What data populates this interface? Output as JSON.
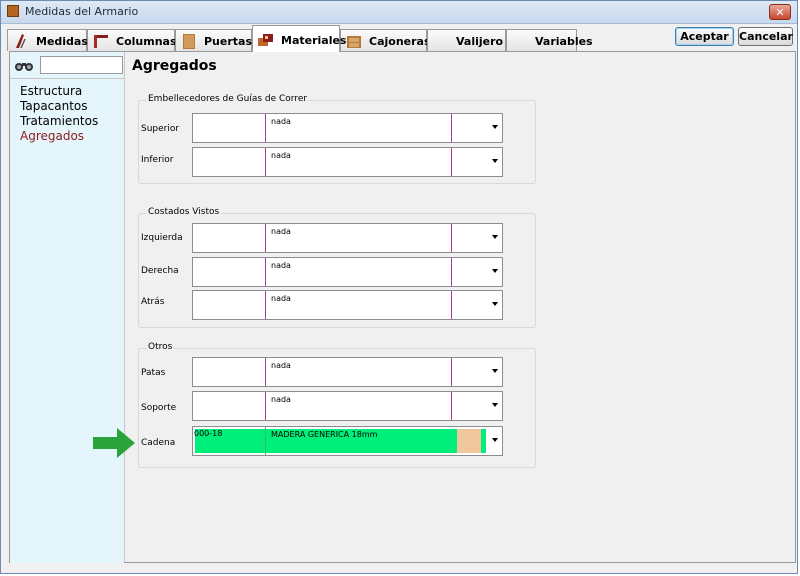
{
  "window": {
    "title": "Medidas del Armario",
    "close_glyph": "✕"
  },
  "tabs": [
    {
      "label": "Medidas",
      "icon": "compass-icon"
    },
    {
      "label": "Columnas",
      "icon": "columns-icon"
    },
    {
      "label": "Puertas",
      "icon": "door-icon"
    },
    {
      "label": "Materiales",
      "icon": "materials-icon",
      "active": true
    },
    {
      "label": "Cajoneras",
      "icon": "drawer-icon"
    },
    {
      "label": "Valijero",
      "icon": ""
    },
    {
      "label": "Variables",
      "icon": ""
    }
  ],
  "buttons": {
    "accept": "Aceptar",
    "cancel": "Cancelar"
  },
  "sidebar": {
    "search_value": "",
    "items": [
      {
        "label": "Estructura"
      },
      {
        "label": "Tapacantos"
      },
      {
        "label": "Tratamientos"
      },
      {
        "label": "Agregados",
        "selected": true
      }
    ]
  },
  "main": {
    "title": "Agregados",
    "groups": [
      {
        "title": "Embellecedores de Guías de Correr",
        "rows": [
          {
            "label": "Superior",
            "code": "",
            "value": "nada"
          },
          {
            "label": "Inferior",
            "code": "",
            "value": "nada"
          }
        ]
      },
      {
        "title": "Costados Vistos",
        "rows": [
          {
            "label": "Izquierda",
            "code": "",
            "value": "nada"
          },
          {
            "label": "Derecha",
            "code": "",
            "value": "nada"
          },
          {
            "label": "Atrás",
            "code": "",
            "value": "nada"
          }
        ]
      },
      {
        "title": "Otros",
        "rows": [
          {
            "label": "Patas",
            "code": "",
            "value": "nada"
          },
          {
            "label": "Soporte",
            "code": "",
            "value": "nada"
          },
          {
            "label": "Cadena",
            "code": "000-18",
            "value": "MADERA GENERICA 18mm",
            "highlight": true
          }
        ]
      }
    ]
  },
  "colors": {
    "highlight": "#00ee7a",
    "swatch": "#f0c79d",
    "marker": "#2aa43a",
    "selected_text": "#8b1c1c"
  }
}
